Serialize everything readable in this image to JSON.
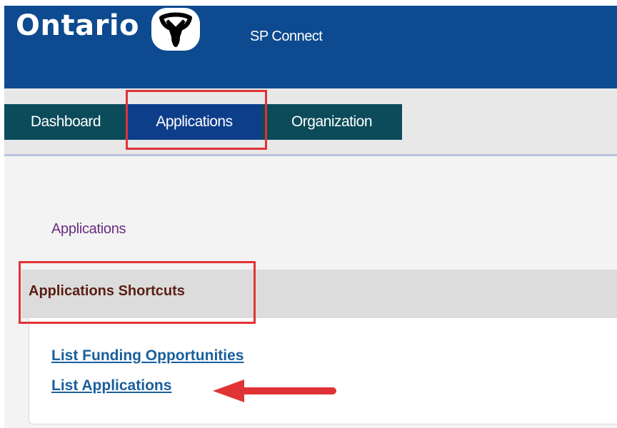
{
  "header": {
    "brand": "Ontario",
    "app_name": "SP Connect",
    "logo_icon": "ontario-trillium-logo"
  },
  "nav": {
    "tabs": [
      {
        "label": "Dashboard"
      },
      {
        "label": "Applications",
        "active": true
      },
      {
        "label": "Organization"
      }
    ]
  },
  "main": {
    "breadcrumb": "Applications",
    "section_title": "Applications Shortcuts",
    "links": [
      {
        "label": "List Funding Opportunities"
      },
      {
        "label": "List Applications"
      }
    ]
  },
  "colors": {
    "header_blue": "#0d4a8f",
    "nav_teal": "#0b4b5a",
    "active_tab": "#0d3e8a",
    "annotation_red": "#e03336",
    "link_blue": "#1a5f9c"
  }
}
